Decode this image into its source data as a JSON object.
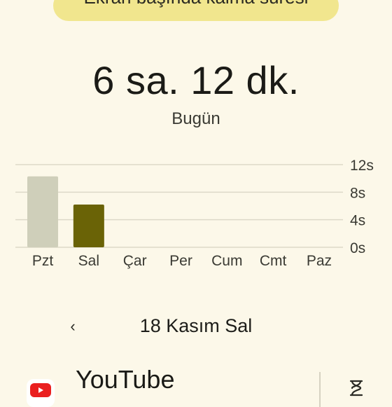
{
  "header": {
    "title": "Ekran başında kalma süresi",
    "total_time": "6 sa. 12 dk.",
    "period": "Bugün"
  },
  "colors": {
    "background": "#fcf8e9",
    "pill": "#f1e68e",
    "bar_past": "#cfcfba",
    "bar_selected": "#6a6306",
    "grid": "#ddd9c8",
    "youtube_red": "#ea1f1f"
  },
  "chart_data": {
    "type": "bar",
    "categories": [
      "Pzt",
      "Sal",
      "Çar",
      "Per",
      "Cum",
      "Cmt",
      "Paz"
    ],
    "values": [
      10.3,
      6.2,
      0,
      0,
      0,
      0,
      0
    ],
    "selected_index": 1,
    "y_ticks": [
      "12s",
      "8s",
      "4s",
      "0s"
    ],
    "y_tick_values": [
      12,
      8,
      4,
      0
    ],
    "ylim": [
      0,
      12
    ],
    "grid": true,
    "y_axis_side": "right"
  },
  "date_nav": {
    "prev_icon": "chevron-left-icon",
    "prev_glyph": "‹",
    "date": "18 Kasım Sal"
  },
  "apps": [
    {
      "name": "YouTube",
      "icon": "youtube-icon",
      "action_icon": "hourglass-icon"
    }
  ]
}
